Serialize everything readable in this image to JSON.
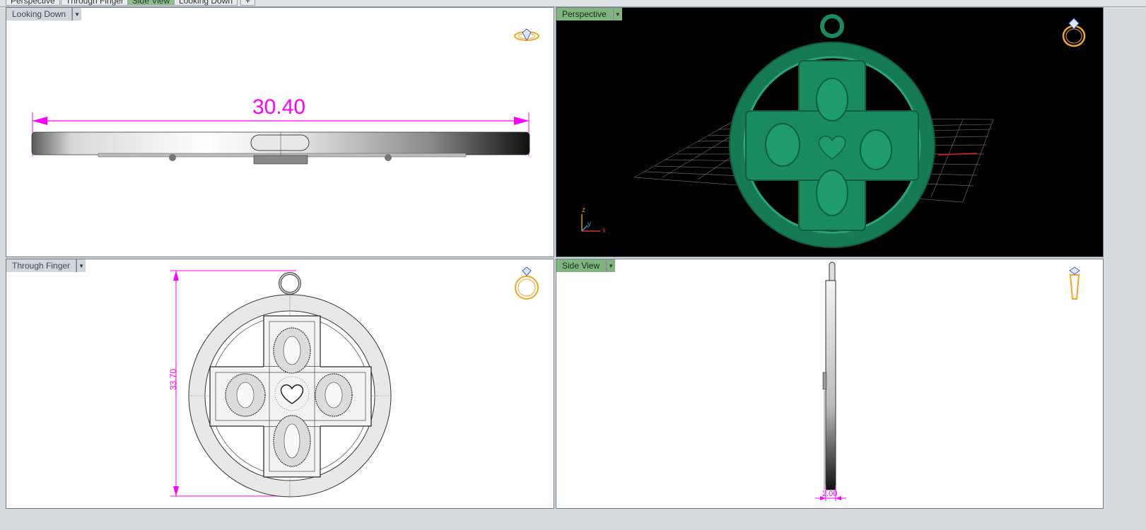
{
  "tabs": [
    {
      "label": "Perspective",
      "active": false
    },
    {
      "label": "Through Finger",
      "active": false
    },
    {
      "label": "Side View",
      "active": true
    },
    {
      "label": "Looking Down",
      "active": false
    },
    {
      "label": "+",
      "active": false
    }
  ],
  "viewports": {
    "top_left": {
      "label": "Looking Down",
      "dimension": "30.40"
    },
    "top_right": {
      "label": "Perspective",
      "axes": {
        "z": "z",
        "y": "y",
        "x": "x"
      }
    },
    "bottom_left": {
      "label": "Through Finger",
      "dimension": "33.70"
    },
    "bottom_right": {
      "label": "Side View",
      "dimension": "2.00"
    }
  },
  "colors": {
    "dimension": "#ff00ff",
    "model_green": "#1a8a5f",
    "active_label": "#7fb47f",
    "ring_icon": "#f5a623"
  },
  "icons": [
    "ring-top-icon",
    "ring-front-icon",
    "ring-side-icon",
    "axis-gizmo-icon",
    "dropdown-arrow-icon"
  ]
}
